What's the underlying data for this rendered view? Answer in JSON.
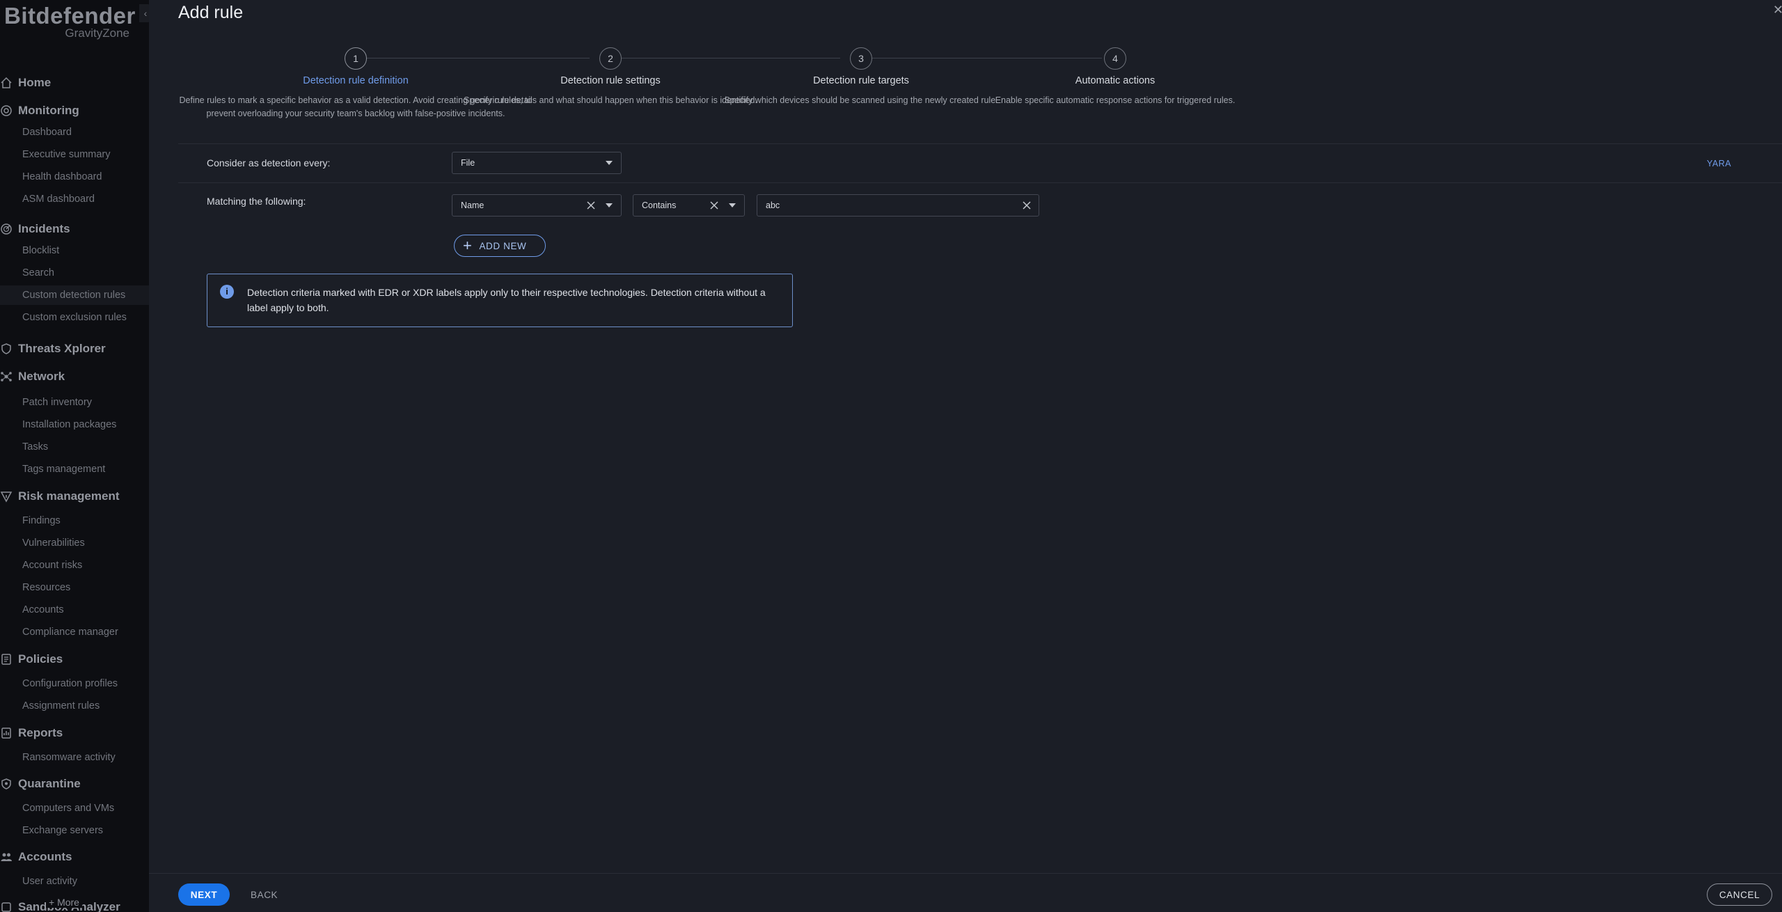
{
  "sidebar": {
    "logo_main": "Bitdefender",
    "logo_sub": "GravityZone",
    "collapse_icon": "chevron-left-icon",
    "more_label": "+ More",
    "groups": [
      {
        "label": "Home",
        "icon": "home-icon"
      },
      {
        "label": "Monitoring",
        "icon": "gauge-icon",
        "items": [
          "Dashboard",
          "Executive summary",
          "Health dashboard",
          "ASM dashboard"
        ]
      },
      {
        "label": "Incidents",
        "icon": "radar-icon",
        "items": [
          "Blocklist",
          "Search",
          "Custom detection rules",
          "Custom exclusion rules"
        ]
      },
      {
        "label": "Threats Xplorer",
        "icon": "shield-icon"
      },
      {
        "label": "Network",
        "icon": "network-icon",
        "items": [
          "Patch inventory",
          "Installation packages",
          "Tasks",
          "Tags management"
        ]
      },
      {
        "label": "Risk management",
        "icon": "risk-icon",
        "items": [
          "Findings",
          "Vulnerabilities",
          "Account risks",
          "Resources",
          "Accounts",
          "Compliance manager"
        ]
      },
      {
        "label": "Policies",
        "icon": "policy-icon",
        "items": [
          "Configuration profiles",
          "Assignment rules"
        ]
      },
      {
        "label": "Reports",
        "icon": "report-icon",
        "items": [
          "Ransomware activity"
        ]
      },
      {
        "label": "Quarantine",
        "icon": "quarantine-icon",
        "items": [
          "Computers and VMs",
          "Exchange servers"
        ]
      },
      {
        "label": "Accounts",
        "icon": "users-icon",
        "items": [
          "User activity"
        ]
      },
      {
        "label": "Sandbox Analyzer",
        "icon": "sandbox-icon"
      }
    ],
    "active_item": "Custom detection rules"
  },
  "header": {
    "title": "Add rule",
    "close_icon": "close-icon"
  },
  "steps": [
    {
      "number": "1",
      "title": "Detection rule definition",
      "desc_lines": [
        "Define rules to mark a specific behavior as a valid detection. Avoid creating generic rules, to",
        "prevent overloading your security team's backlog with false-positive incidents."
      ],
      "active": true
    },
    {
      "number": "2",
      "title": "Detection rule settings",
      "desc_lines": [
        "Specify rule details and what should happen when this behavior is identified."
      ],
      "active": false
    },
    {
      "number": "3",
      "title": "Detection rule targets",
      "desc_lines": [
        "Specify which devices should be scanned using the newly created rule."
      ],
      "active": false
    },
    {
      "number": "4",
      "title": "Automatic actions",
      "desc_lines": [
        "Enable specific automatic response actions for triggered rules."
      ],
      "active": false
    }
  ],
  "form": {
    "detection_label": "Consider as detection every:",
    "detection_value": "File",
    "yara_link": "YARA",
    "matching_label": "Matching the following:",
    "field_value": "Name",
    "operator_value": "Contains",
    "text_value": "abc",
    "add_new_label": "ADD NEW"
  },
  "info": {
    "icon": "info-icon",
    "line1": "Detection criteria marked with EDR or XDR labels apply only to their respective technologies. Detection criteria without a",
    "line2": "label apply to both."
  },
  "footer": {
    "next_label": "NEXT",
    "back_label": "BACK",
    "cancel_label": "CANCEL"
  },
  "colors": {
    "accent": "#1a73e8",
    "link": "#6f9be8",
    "background": "#1b1e26",
    "sidebar": "#0d0e12"
  }
}
